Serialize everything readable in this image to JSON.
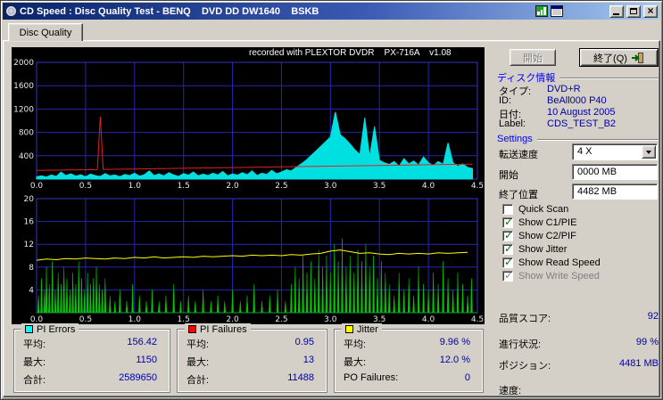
{
  "window": {
    "title": "CD Speed : Disc Quality Test - BENQ    DVD DD DW1640    BSKB"
  },
  "icons": {
    "close": "×",
    "check": "✓"
  },
  "tab": {
    "label": "Disc Quality"
  },
  "chart_header": "recorded with PLEXTOR DVDR    PX-716A    v1.08",
  "buttons": {
    "start": "開始",
    "exit": "終了(Q)"
  },
  "disc_info": {
    "header": "ディスク情報",
    "rows": [
      {
        "label": "タイプ:",
        "value": "DVD+R"
      },
      {
        "label": "ID:",
        "value": "BeAll000 P40"
      },
      {
        "label": "日付:",
        "value": "10 August 2005"
      },
      {
        "label": "Label:",
        "value": "CDS_TEST_B2"
      }
    ]
  },
  "settings": {
    "header": "Settings",
    "speed_label": "転送速度",
    "speed_value": "4 X",
    "start_label": "開始",
    "start_value": "0000 MB",
    "end_label": "終了位置",
    "end_value": "4482 MB",
    "checkboxes": [
      {
        "label": "Quick Scan",
        "checked": false,
        "enabled": true
      },
      {
        "label": "Show C1/PIE",
        "checked": true,
        "enabled": true
      },
      {
        "label": "Show C2/PIF",
        "checked": true,
        "enabled": true
      },
      {
        "label": "Show Jitter",
        "checked": true,
        "enabled": true
      },
      {
        "label": "Show Read Speed",
        "checked": true,
        "enabled": true
      },
      {
        "label": "Show Write Speed",
        "checked": true,
        "enabled": false
      }
    ],
    "score_label": "品質スコア:",
    "score_value": "92"
  },
  "progress": {
    "rows": [
      {
        "label": "進行状況:",
        "value": "99 %"
      },
      {
        "label": "ポジション:",
        "value": "4481 MB"
      },
      {
        "label": "速度:",
        "value": ""
      }
    ]
  },
  "stats": [
    {
      "title": "PI Errors",
      "color": "#00ffff",
      "rows": [
        {
          "label": "平均:",
          "value": "156.42"
        },
        {
          "label": "最大:",
          "value": "1150"
        },
        {
          "label": "合計:",
          "value": "2589650"
        }
      ]
    },
    {
      "title": "PI Failures",
      "color": "#ff0000",
      "rows": [
        {
          "label": "平均:",
          "value": "0.95"
        },
        {
          "label": "最大:",
          "value": "13"
        },
        {
          "label": "合計:",
          "value": "11488"
        }
      ]
    },
    {
      "title": "Jitter",
      "color": "#ffff00",
      "rows": [
        {
          "label": "平均:",
          "value": "9.96 %"
        },
        {
          "label": "最大:",
          "value": "12.0 %"
        },
        {
          "label": "PO Failures:",
          "value": "0"
        }
      ]
    }
  ],
  "chart_data": [
    {
      "type": "area",
      "title": "recorded with PLEXTOR DVDR    PX-716A    v1.08",
      "xlim": [
        0,
        4.5
      ],
      "ylim": [
        0,
        2000
      ],
      "x_ticks": [
        "0.0",
        "0.5",
        "1.0",
        "1.5",
        "2.0",
        "2.5",
        "3.0",
        "3.5",
        "4.0",
        "4.5"
      ],
      "y_ticks": [
        400,
        800,
        1200,
        1600,
        2000
      ],
      "grid": true,
      "legend_position": "none",
      "series": [
        {
          "name": "PI Errors (C1/PIE)",
          "style": "area",
          "color": "#00e0e0",
          "x_start": 0,
          "x_step": 0.05,
          "values": [
            40,
            55,
            35,
            70,
            45,
            120,
            60,
            90,
            50,
            75,
            40,
            85,
            60,
            45,
            95,
            55,
            70,
            40,
            80,
            60,
            100,
            50,
            75,
            140,
            60,
            90,
            55,
            110,
            70,
            45,
            95,
            65,
            120,
            55,
            85,
            60,
            100,
            70,
            130,
            55,
            90,
            65,
            110,
            75,
            140,
            60,
            100,
            80,
            150,
            90,
            120,
            160,
            140,
            200,
            260,
            320,
            400,
            480,
            560,
            640,
            720,
            1150,
            760,
            690,
            600,
            500,
            420,
            1050,
            380,
            900,
            320,
            280,
            250,
            300,
            220,
            350,
            260,
            310,
            240,
            380,
            280,
            230,
            300,
            250,
            620,
            280,
            220,
            260,
            200,
            180
          ]
        },
        {
          "name": "Read Speed",
          "style": "line",
          "color": "#e02020",
          "points": [
            [
              0,
              150
            ],
            [
              0.55,
              160
            ],
            [
              0.62,
              162
            ],
            [
              0.65,
              1070
            ],
            [
              0.68,
              165
            ],
            [
              1,
              172
            ],
            [
              1.5,
              185
            ],
            [
              2,
              197
            ],
            [
              2.5,
              210
            ],
            [
              3,
              222
            ],
            [
              3.5,
              234
            ],
            [
              4,
              246
            ],
            [
              4.45,
              255
            ]
          ]
        }
      ]
    },
    {
      "type": "mixed",
      "xlim": [
        0,
        4.5
      ],
      "ylim": [
        0,
        20
      ],
      "x_ticks": [
        "0.0",
        "0.5",
        "1.0",
        "1.5",
        "2.0",
        "2.5",
        "3.0",
        "3.5",
        "4.0",
        "4.5"
      ],
      "y_ticks": [
        4,
        8,
        12,
        16,
        20
      ],
      "grid": true,
      "legend_position": "none",
      "series": [
        {
          "name": "PI Failures (C2/PIF)",
          "style": "spikes",
          "color": "#00c800",
          "points": [
            [
              0.02,
              3
            ],
            [
              0.05,
              6
            ],
            [
              0.08,
              4
            ],
            [
              0.1,
              8
            ],
            [
              0.13,
              5
            ],
            [
              0.16,
              9
            ],
            [
              0.19,
              4
            ],
            [
              0.22,
              7
            ],
            [
              0.25,
              5
            ],
            [
              0.28,
              8
            ],
            [
              0.31,
              6
            ],
            [
              0.34,
              4
            ],
            [
              0.37,
              7
            ],
            [
              0.4,
              5
            ],
            [
              0.43,
              9
            ],
            [
              0.46,
              6
            ],
            [
              0.49,
              4
            ],
            [
              0.52,
              7
            ],
            [
              0.55,
              5
            ],
            [
              0.58,
              6
            ],
            [
              0.61,
              8
            ],
            [
              0.64,
              5
            ],
            [
              0.67,
              4
            ],
            [
              0.7,
              6
            ],
            [
              0.75,
              3
            ],
            [
              0.8,
              2
            ],
            [
              0.85,
              4
            ],
            [
              0.92,
              2
            ],
            [
              0.98,
              5
            ],
            [
              1.05,
              3
            ],
            [
              1.12,
              2
            ],
            [
              1.18,
              4
            ],
            [
              1.25,
              2
            ],
            [
              1.32,
              3
            ],
            [
              1.4,
              5
            ],
            [
              1.47,
              2
            ],
            [
              1.55,
              3
            ],
            [
              1.62,
              2
            ],
            [
              1.7,
              4
            ],
            [
              1.78,
              2
            ],
            [
              1.85,
              3
            ],
            [
              1.92,
              2
            ],
            [
              2,
              4
            ],
            [
              2.08,
              2
            ],
            [
              2.15,
              3
            ],
            [
              2.22,
              5
            ],
            [
              2.3,
              2
            ],
            [
              2.38,
              3
            ],
            [
              2.46,
              4
            ],
            [
              2.54,
              2
            ],
            [
              2.6,
              5
            ],
            [
              2.64,
              8
            ],
            [
              2.68,
              6
            ],
            [
              2.72,
              10
            ],
            [
              2.76,
              7
            ],
            [
              2.8,
              9
            ],
            [
              2.84,
              6
            ],
            [
              2.88,
              11
            ],
            [
              2.92,
              8
            ],
            [
              2.96,
              10
            ],
            [
              3,
              7
            ],
            [
              3.04,
              12
            ],
            [
              3.08,
              9
            ],
            [
              3.12,
              13
            ],
            [
              3.16,
              8
            ],
            [
              3.2,
              10
            ],
            [
              3.24,
              7
            ],
            [
              3.28,
              11
            ],
            [
              3.32,
              9
            ],
            [
              3.36,
              12
            ],
            [
              3.4,
              8
            ],
            [
              3.44,
              10
            ],
            [
              3.48,
              6
            ],
            [
              3.52,
              9
            ],
            [
              3.56,
              7
            ],
            [
              3.6,
              5
            ],
            [
              3.65,
              3
            ],
            [
              3.7,
              7
            ],
            [
              3.75,
              4
            ],
            [
              3.8,
              6
            ],
            [
              3.85,
              3
            ],
            [
              3.9,
              8
            ],
            [
              3.95,
              5
            ],
            [
              4,
              4
            ],
            [
              4.05,
              7
            ],
            [
              4.1,
              5
            ],
            [
              4.15,
              9
            ],
            [
              4.2,
              6
            ],
            [
              4.25,
              4
            ],
            [
              4.3,
              7
            ],
            [
              4.35,
              5
            ],
            [
              4.4,
              3
            ],
            [
              4.44,
              6
            ]
          ]
        },
        {
          "name": "Jitter",
          "style": "line",
          "color": "#ffff00",
          "x_start": 0,
          "x_step": 0.1,
          "values": [
            9.2,
            9.4,
            9.3,
            9.5,
            9.4,
            9.6,
            9.5,
            9.4,
            9.6,
            9.5,
            9.7,
            9.6,
            9.8,
            9.6,
            9.7,
            9.8,
            9.7,
            9.9,
            9.8,
            9.9,
            10,
            9.9,
            10.1,
            10,
            10.1,
            10,
            10.2,
            10.1,
            10.3,
            10.4,
            10.8,
            11,
            10.7,
            10.4,
            10.5,
            10.3,
            10.2,
            10.4,
            10.3,
            10.4,
            10.3,
            10.5,
            10.4,
            10.5,
            10.6
          ]
        }
      ]
    }
  ]
}
